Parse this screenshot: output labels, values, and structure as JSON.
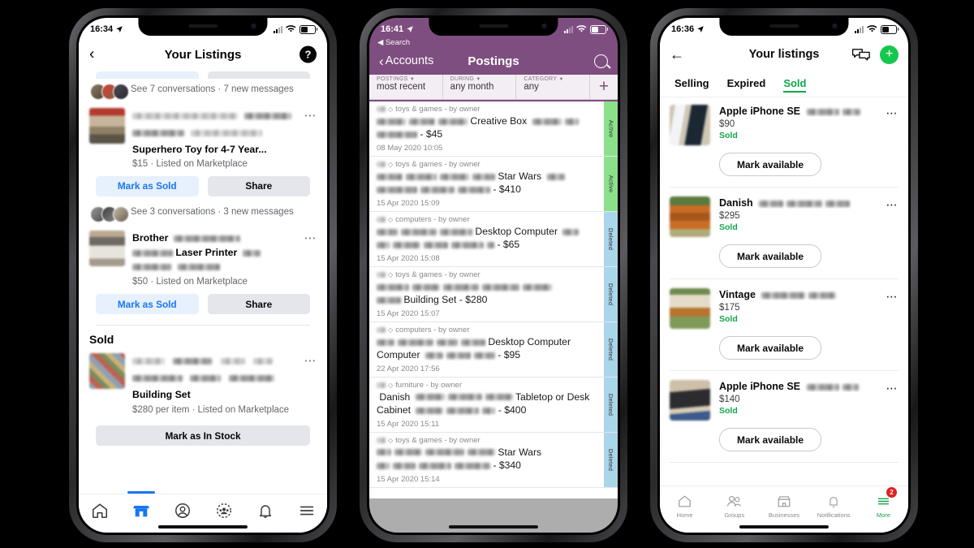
{
  "phone1": {
    "status": {
      "time": "16:34",
      "location_icon": "location-arrow-icon"
    },
    "nav": {
      "back_icon": "chevron-left-icon",
      "title": "Your Listings",
      "help_label": "?"
    },
    "conversations": [
      {
        "text": "See 7 conversations · 7 new messages"
      },
      {
        "text": "See 3 conversations · 3 new messages"
      }
    ],
    "listings": [
      {
        "title": "Superhero Toy for 4-7 Year...",
        "meta": "$15 · Listed on Marketplace",
        "redacted_lines": 2,
        "buttons": {
          "primary": "Mark as Sold",
          "secondary": "Share"
        }
      },
      {
        "title_prefix": "Brother",
        "title_mid": "Laser Printer",
        "meta": "$50 · Listed on Marketplace",
        "buttons": {
          "primary": "Mark as Sold",
          "secondary": "Share"
        }
      }
    ],
    "sold_section": {
      "header": "Sold",
      "item": {
        "title": "Building Set",
        "meta": "$280 per item · Listed on Marketplace",
        "button": "Mark as In Stock"
      }
    },
    "tabbar": [
      {
        "name": "home-icon",
        "label": "Home",
        "active": false
      },
      {
        "name": "marketplace-icon",
        "label": "Marketplace",
        "active": true
      },
      {
        "name": "profile-icon",
        "label": "Profile",
        "active": false
      },
      {
        "name": "groups-icon",
        "label": "Groups",
        "active": false
      },
      {
        "name": "bell-icon",
        "label": "Notifications",
        "active": false
      },
      {
        "name": "menu-icon",
        "label": "Menu",
        "active": false
      }
    ],
    "colors": {
      "accent": "#1877f2",
      "chip_blue": "#e7f0fd",
      "chip_gray": "#e4e6eb",
      "text": "#050505",
      "muted": "#65676b"
    }
  },
  "phone2": {
    "status": {
      "time": "16:41"
    },
    "back_to_app": "◀ Search",
    "nav": {
      "back_label": "Accounts",
      "title": "Postings",
      "search_icon": "magnifier-icon"
    },
    "filters": [
      {
        "label": "POSTINGS",
        "value": "most recent"
      },
      {
        "label": "DURING",
        "value": "any month"
      },
      {
        "label": "CATEGORY",
        "value": "any"
      }
    ],
    "add_label": "+",
    "posts": [
      {
        "category": "toys & games - by owner",
        "title_visible": "Creative Box",
        "price": "$45",
        "date": "08 May 2020 10:05",
        "status": "Active"
      },
      {
        "category": "toys & games - by owner",
        "title_visible": "Star Wars",
        "price": "$410",
        "date": "15 Apr 2020 15:09",
        "status": "Active"
      },
      {
        "category": "computers - by owner",
        "title_visible": "Desktop Computer",
        "price": "$65",
        "date": "15 Apr 2020 15:08",
        "status": "Deleted"
      },
      {
        "category": "toys & games - by owner",
        "title_visible": "Building Set",
        "price": "$280",
        "date": "15 Apr 2020 15:07",
        "status": "Deleted"
      },
      {
        "category": "computers - by owner",
        "title_visible": "Desktop Computer",
        "price": "$95",
        "date": "22 Apr 2020 17:56",
        "status": "Deleted"
      },
      {
        "category": "furniture - by owner",
        "title_visible": "Danish",
        "title_visible2": "Tabletop or Desk Cabinet",
        "price": "$400",
        "date": "15 Apr 2020 15:11",
        "status": "Deleted"
      },
      {
        "category": "toys & games - by owner",
        "title_visible": "Star Wars",
        "price": "$340",
        "date": "15 Apr 2020 15:14",
        "status": "Deleted"
      }
    ],
    "colors": {
      "header_purple": "#7f4e80",
      "filter_bg": "#f3eef3",
      "active_tag": "#8ce08c",
      "deleted_tag": "#aad6ea",
      "footer": "#adadad"
    }
  },
  "phone3": {
    "status": {
      "time": "16:36"
    },
    "nav": {
      "back_icon": "arrow-left-icon",
      "title": "Your listings",
      "chat_icon": "chat-bubbles-icon",
      "add_icon": "plus-icon"
    },
    "tabs": [
      {
        "label": "Selling",
        "active": false
      },
      {
        "label": "Expired",
        "active": false
      },
      {
        "label": "Sold",
        "active": true
      }
    ],
    "listings": [
      {
        "title": "Apple iPhone SE",
        "price": "$90",
        "status": "Sold",
        "button": "Mark available"
      },
      {
        "title": "Danish",
        "price": "$295",
        "status": "Sold",
        "button": "Mark available"
      },
      {
        "title": "Vintage",
        "price": "$175",
        "status": "Sold",
        "button": "Mark available"
      },
      {
        "title": "Apple iPhone SE",
        "price": "$140",
        "status": "Sold",
        "button": "Mark available"
      }
    ],
    "tabbar": [
      {
        "icon": "home-icon",
        "label": "Home",
        "active": false,
        "badge": ""
      },
      {
        "icon": "groups-icon",
        "label": "Groups",
        "active": false,
        "badge": ""
      },
      {
        "icon": "businesses-icon",
        "label": "Businesses",
        "active": false,
        "badge": ""
      },
      {
        "icon": "bell-icon",
        "label": "Notifications",
        "active": false,
        "badge": ""
      },
      {
        "icon": "more-icon",
        "label": "More",
        "active": true,
        "badge": "2"
      }
    ],
    "colors": {
      "accent": "#12a64a",
      "add_button": "#16c74e",
      "badge": "#e02020"
    }
  }
}
